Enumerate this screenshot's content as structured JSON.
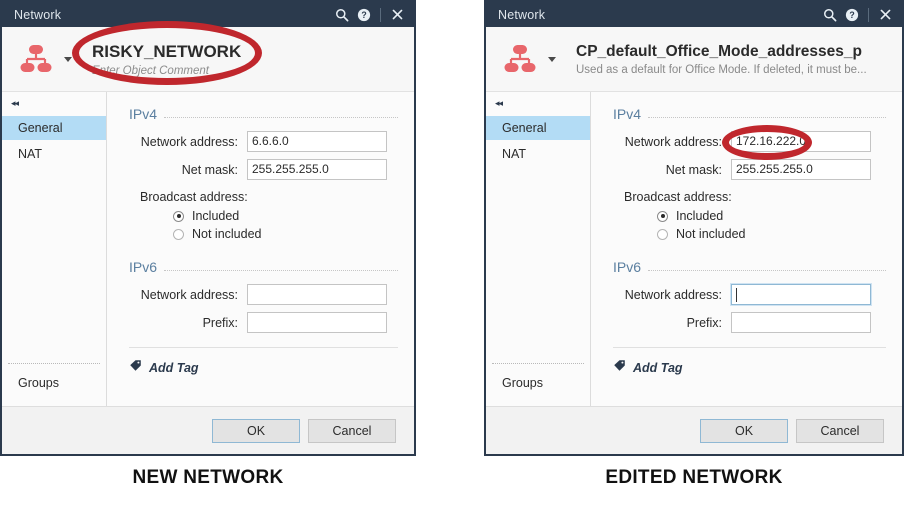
{
  "colors": {
    "titlebar_bg": "#2b3a4d",
    "accent_blue": "#b3dcf5",
    "section_label": "#5b7fa0",
    "icon_red": "#e8666b",
    "annotation_red": "#c0272d"
  },
  "dialogs": [
    {
      "id": "new-network",
      "titlebar": {
        "title": "Network",
        "search_icon": "search-icon",
        "help_icon": "help-icon",
        "close_icon": "close-icon"
      },
      "object_header": {
        "icon": "network-object-icon",
        "dropdown_icon": "chevron-down-icon",
        "name": "RISKY_NETWORK",
        "comment": "Enter Object Comment",
        "comment_is_placeholder": true
      },
      "sidebar": {
        "collapse_icon": "collapse-panel-icon",
        "items": [
          {
            "label": "General",
            "active": true
          },
          {
            "label": "NAT",
            "active": false
          }
        ],
        "bottom_item": "Groups"
      },
      "sections": [
        {
          "title": "IPv4",
          "fields": [
            {
              "label": "Network address:",
              "value": "6.6.6.0",
              "placeholder": "",
              "focused": false
            },
            {
              "label": "Net mask:",
              "value": "255.255.255.0",
              "placeholder": "",
              "focused": false
            }
          ],
          "radio_group": {
            "label": "Broadcast address:",
            "options": [
              {
                "label": "Included",
                "selected": true
              },
              {
                "label": "Not included",
                "selected": false
              }
            ]
          }
        },
        {
          "title": "IPv6",
          "fields": [
            {
              "label": "Network address:",
              "value": "",
              "placeholder": "",
              "focused": false
            },
            {
              "label": "Prefix:",
              "value": "",
              "placeholder": "",
              "focused": false
            }
          ]
        }
      ],
      "add_tag": {
        "icon": "tag-icon",
        "label": "Add Tag"
      },
      "footer": {
        "ok_label": "OK",
        "cancel_label": "Cancel"
      },
      "caption": "NEW NETWORK",
      "annotation": {
        "shape": "ellipse",
        "target": "object-name-block"
      }
    },
    {
      "id": "edited-network",
      "titlebar": {
        "title": "Network",
        "search_icon": "search-icon",
        "help_icon": "help-icon",
        "close_icon": "close-icon"
      },
      "object_header": {
        "icon": "network-object-icon",
        "dropdown_icon": "chevron-down-icon",
        "name": "CP_default_Office_Mode_addresses_p",
        "comment": "Used as a default for Office Mode. If deleted, it must be...",
        "comment_is_placeholder": false
      },
      "sidebar": {
        "collapse_icon": "collapse-panel-icon",
        "items": [
          {
            "label": "General",
            "active": true
          },
          {
            "label": "NAT",
            "active": false
          }
        ],
        "bottom_item": "Groups"
      },
      "sections": [
        {
          "title": "IPv4",
          "fields": [
            {
              "label": "Network address:",
              "value": "172.16.222.0",
              "placeholder": "",
              "focused": false
            },
            {
              "label": "Net mask:",
              "value": "255.255.255.0",
              "placeholder": "",
              "focused": false
            }
          ],
          "radio_group": {
            "label": "Broadcast address:",
            "options": [
              {
                "label": "Included",
                "selected": true
              },
              {
                "label": "Not included",
                "selected": false
              }
            ]
          }
        },
        {
          "title": "IPv6",
          "fields": [
            {
              "label": "Network address:",
              "value": "",
              "placeholder": "",
              "focused": true
            },
            {
              "label": "Prefix:",
              "value": "",
              "placeholder": "",
              "focused": false
            }
          ]
        }
      ],
      "add_tag": {
        "icon": "tag-icon",
        "label": "Add Tag"
      },
      "footer": {
        "ok_label": "OK",
        "cancel_label": "Cancel"
      },
      "caption": "EDITED NETWORK",
      "annotation": {
        "shape": "ellipse",
        "target": "ipv4-network-address-input"
      }
    }
  ]
}
